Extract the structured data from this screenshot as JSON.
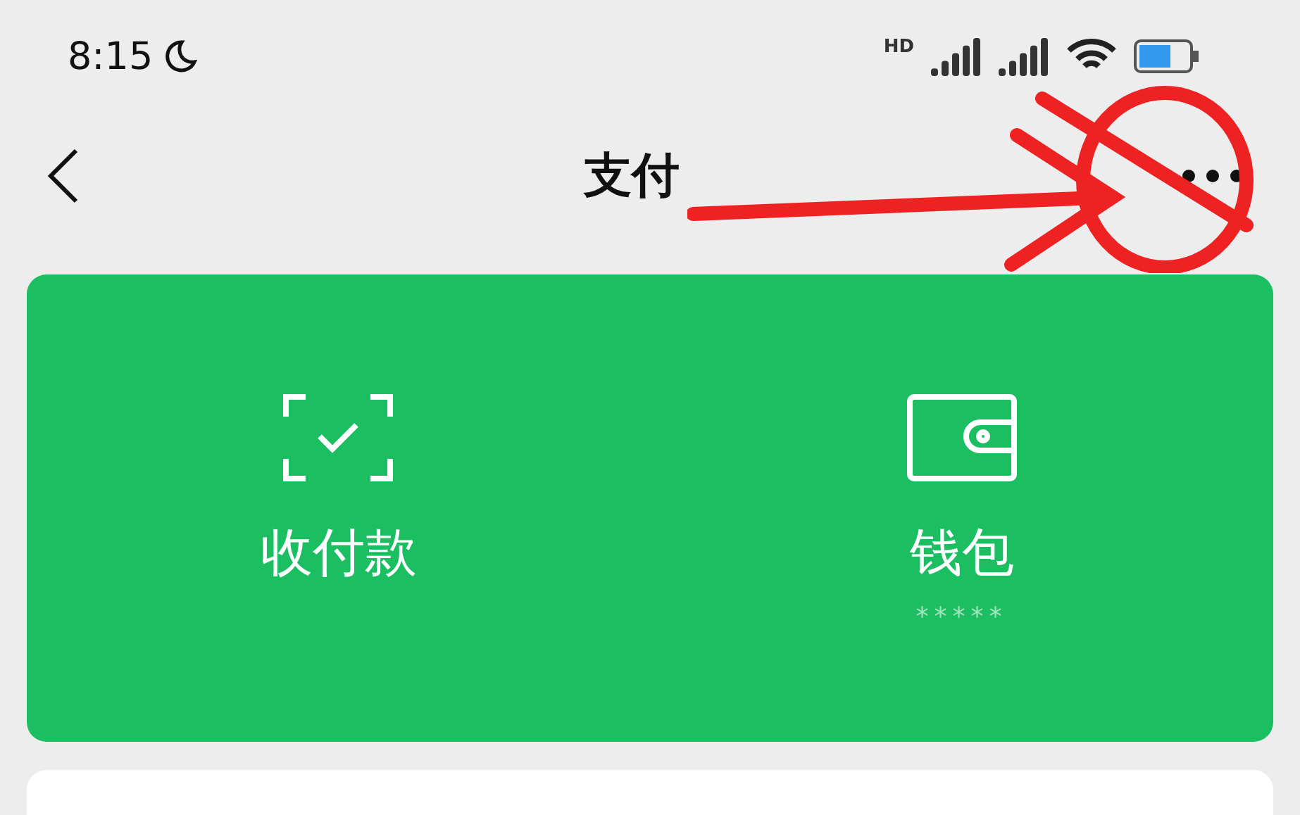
{
  "status_bar": {
    "time": "8:15",
    "network_label": "HD"
  },
  "nav_bar": {
    "title": "支付"
  },
  "pay_card": {
    "items": [
      {
        "kind": "scan",
        "label": "收付款"
      },
      {
        "kind": "wallet",
        "label": "钱包",
        "sub": "*****"
      }
    ]
  }
}
